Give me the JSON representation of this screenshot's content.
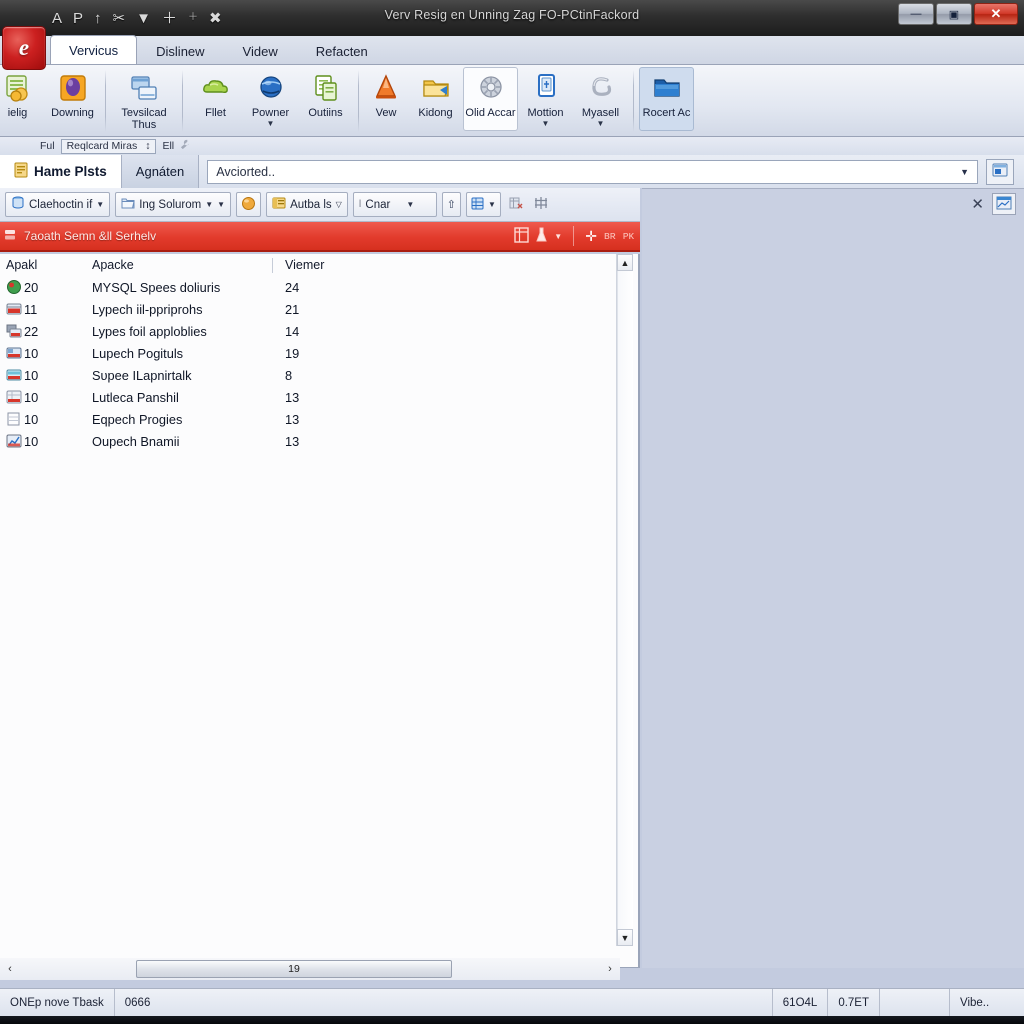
{
  "window": {
    "title": "Verv Resig en Unning Zag FO-PCtinFackord",
    "minimize": "—",
    "maximize": "▣",
    "close": "✕"
  },
  "quick_access": {
    "items": [
      {
        "name": "qat-a",
        "glyph": "A"
      },
      {
        "name": "qat-p",
        "glyph": "P"
      },
      {
        "name": "qat-up",
        "glyph": "↑"
      },
      {
        "name": "qat-cut",
        "glyph": "✂"
      },
      {
        "name": "qat-dropdown",
        "glyph": "▼"
      },
      {
        "name": "qat-add",
        "glyph": "＋"
      },
      {
        "name": "qat-small",
        "glyph": "＋"
      },
      {
        "name": "qat-pin",
        "glyph": "✖"
      }
    ]
  },
  "orb": {
    "label": "e"
  },
  "ribbon": {
    "tabs": [
      {
        "label": "Vervicus",
        "active": true
      },
      {
        "label": "Dislinew",
        "active": false
      },
      {
        "label": "Videw",
        "active": false
      },
      {
        "label": "Refacten",
        "active": false
      }
    ],
    "groups": [
      {
        "items": [
          {
            "label": "ielig",
            "icon": "money-report-icon",
            "caret": false,
            "state": ""
          },
          {
            "label": "Downing",
            "icon": "egg-orange-icon",
            "caret": false,
            "state": ""
          }
        ]
      },
      {
        "items": [
          {
            "label": "Tevsilcad Thus",
            "icon": "windows-stack-icon",
            "caret": false,
            "state": ""
          }
        ]
      },
      {
        "items": [
          {
            "label": "Fllet",
            "icon": "green-cloud-icon",
            "caret": false,
            "state": ""
          },
          {
            "label": "Powner",
            "icon": "blue-globe-icon",
            "caret": true,
            "state": ""
          },
          {
            "label": "Outiins",
            "icon": "green-document-icon",
            "caret": false,
            "state": ""
          }
        ]
      },
      {
        "items": [
          {
            "label": "Vew",
            "icon": "orange-cone-icon",
            "caret": false,
            "state": ""
          },
          {
            "label": "Kidong",
            "icon": "yellow-folder-tag-icon",
            "caret": false,
            "state": ""
          },
          {
            "label": "Olid Accar",
            "icon": "gray-gear-wheel-icon",
            "caret": false,
            "state": "sel"
          },
          {
            "label": "Mottion",
            "icon": "blue-card-icon",
            "caret": true,
            "state": ""
          },
          {
            "label": "Myasell",
            "icon": "gray-swirl-icon",
            "caret": true,
            "state": ""
          }
        ]
      },
      {
        "items": [
          {
            "label": "Rocert Ac",
            "icon": "blue-folder-icon",
            "caret": false,
            "state": "sel2"
          }
        ]
      }
    ]
  },
  "mini_row": {
    "prefix": "Ful",
    "box_label": "Reqlcard Miras",
    "box_glyph": "↕",
    "suffix": "Ell",
    "trailing_icon": "wrench-icon"
  },
  "address_row": {
    "doc_tab": "Hame Plsts",
    "doc_tab_icon": "document-icon",
    "second_tab": "Agnáten",
    "combo_value": "Avciorted..",
    "combo_placeholder": "Avciorted..",
    "combo_caret": "▼",
    "go_button_icon": "window-launch-icon"
  },
  "toolbar2": {
    "items": [
      {
        "name": "connection-dropdown",
        "label": "Claehoctin if",
        "icon": "db-connection-icon",
        "caret": "▼"
      },
      {
        "name": "solution-dropdown",
        "label": "Ing Solurom",
        "icon": "folder-open-icon",
        "caret": "▼",
        "caret2": "▼"
      },
      {
        "name": "refresh-button",
        "label": "",
        "icon": "orange-sphere-icon",
        "caret": ""
      },
      {
        "name": "autoba-dropdown",
        "label": "Autba ls",
        "icon": "yellow-list-icon",
        "caret": "▽"
      },
      {
        "name": "char-dropdown",
        "label": "Cnar",
        "icon": "char-icon",
        "caret": "▼"
      },
      {
        "name": "up-button",
        "label": "",
        "icon": "arrow-up-icon",
        "caret": ""
      },
      {
        "name": "grid-dropdown",
        "label": "",
        "icon": "blue-grid-icon",
        "caret": "▼"
      },
      {
        "name": "delete-flat-button",
        "label": "",
        "icon": "delete-table-icon",
        "caret": ""
      },
      {
        "name": "columns-flat-button",
        "label": "",
        "icon": "columns-icon",
        "caret": ""
      }
    ]
  },
  "red_bar": {
    "icon": "server-icon",
    "title": "7aoath Semn &ll Serhelv",
    "buttons": [
      {
        "name": "grid-view-icon",
        "glyph": "▤"
      },
      {
        "name": "filter-flask-icon",
        "glyph": "⚗"
      },
      {
        "name": "filter-caret-icon",
        "glyph": "▼"
      },
      {
        "name": "add-clover-icon",
        "glyph": "☘"
      },
      {
        "name": "script-a-icon",
        "glyph": "ʙʀ"
      },
      {
        "name": "script-b-icon",
        "glyph": "ᴘᴋ"
      }
    ]
  },
  "list": {
    "columns": [
      "Apakl",
      "Apacke",
      "Viemer"
    ],
    "rows": [
      {
        "count": "20",
        "name": "MYSQL Spees doliuris",
        "value": "24",
        "icon": "mysql-icon"
      },
      {
        "count": "11",
        "name": "Lypech iil-ppriprohs",
        "value": "21",
        "icon": "db-red-icon"
      },
      {
        "count": "22",
        "name": "Lypes foil  apploblies",
        "value": "14",
        "icon": "db-multi-icon"
      },
      {
        "count": "10",
        "name": "Lupech Pogituls",
        "value": "19",
        "icon": "db-blue-icon"
      },
      {
        "count": "10",
        "name": "Sυpee ILapnirtalk",
        "value": "8",
        "icon": "db-cyan-icon"
      },
      {
        "count": "10",
        "name": "Lutleca Panshil",
        "value": "13",
        "icon": "db-gray-icon"
      },
      {
        "count": "10",
        "name": "Eqpech Progies",
        "value": "13",
        "icon": "doc-plain-icon"
      },
      {
        "count": "10",
        "name": "Oupech Bnamii",
        "value": "13",
        "icon": "db-chart-icon"
      }
    ]
  },
  "scrollbars": {
    "v_up": "▲",
    "v_down": "▼",
    "h_left": "‹",
    "h_right": "›",
    "h_thumb_label": "19"
  },
  "right_pane": {
    "close": "✕",
    "panel_icon": "preview-window-icon"
  },
  "status_bar": {
    "left": "ONEp nove  Tbask",
    "second": "0666",
    "right_cells": [
      "61O4L",
      "0.7ET",
      "",
      "Vibe.."
    ]
  }
}
